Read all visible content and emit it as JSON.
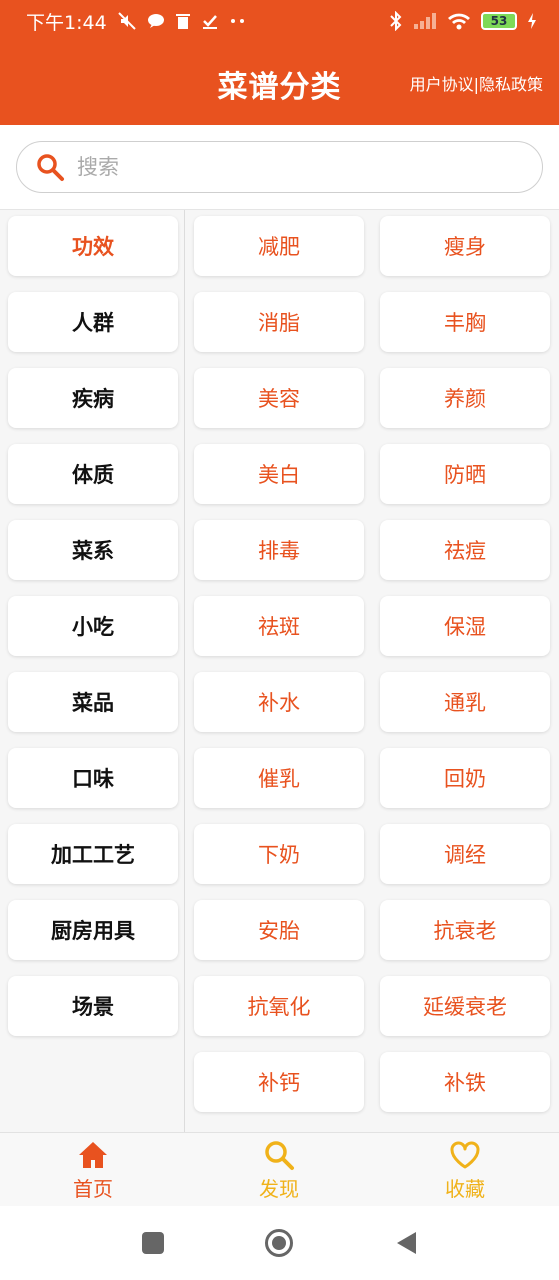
{
  "status": {
    "time": "下午1:44",
    "battery": "53"
  },
  "header": {
    "title": "菜谱分类",
    "policy_link": "用户协议|隐私政策"
  },
  "search": {
    "placeholder": "搜索"
  },
  "categories": [
    {
      "label": "功效",
      "active": true
    },
    {
      "label": "人群"
    },
    {
      "label": "疾病"
    },
    {
      "label": "体质"
    },
    {
      "label": "菜系"
    },
    {
      "label": "小吃"
    },
    {
      "label": "菜品"
    },
    {
      "label": "口味"
    },
    {
      "label": "加工工艺"
    },
    {
      "label": "厨房用具"
    },
    {
      "label": "场景"
    }
  ],
  "subcategories": [
    "减肥",
    "瘦身",
    "消脂",
    "丰胸",
    "美容",
    "养颜",
    "美白",
    "防晒",
    "排毒",
    "祛痘",
    "祛斑",
    "保湿",
    "补水",
    "通乳",
    "催乳",
    "回奶",
    "下奶",
    "调经",
    "安胎",
    "抗衰老",
    "抗氧化",
    "延缓衰老",
    "补钙",
    "补铁"
  ],
  "tabs": [
    {
      "label": "首页",
      "icon": "home-icon",
      "color": "#e8521f"
    },
    {
      "label": "发现",
      "icon": "search-icon",
      "color": "#f0b21a"
    },
    {
      "label": "收藏",
      "icon": "heart-icon",
      "color": "#f0b21a"
    }
  ],
  "colors": {
    "brand": "#e8521f",
    "tab_inactive": "#f0b21a"
  }
}
